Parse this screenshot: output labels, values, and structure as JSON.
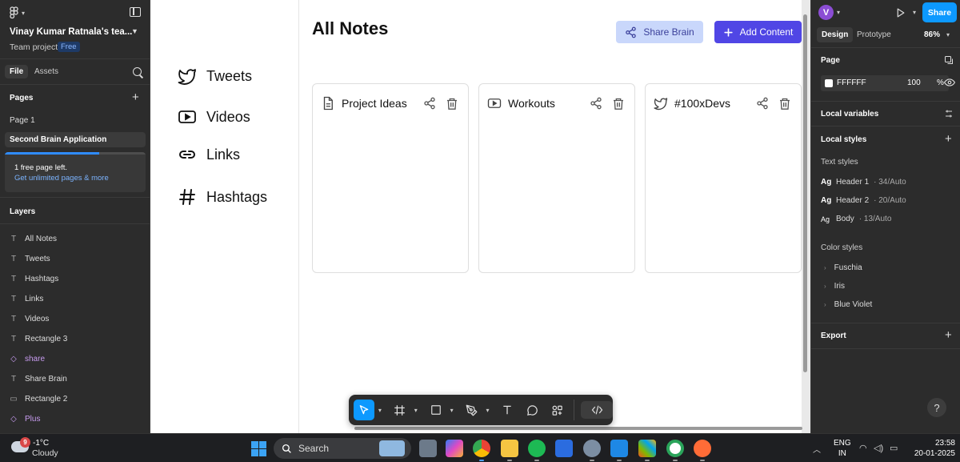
{
  "left_panel": {
    "team_name": "Vinay Kumar Ratnala's tea...",
    "team_project": "Team project",
    "plan_badge": "Free",
    "tabs": [
      "File",
      "Assets"
    ],
    "pages_title": "Pages",
    "pages": [
      "Page 1",
      "Second Brain Application"
    ],
    "upsell": {
      "line1": "1 free page left.",
      "line2": "Get unlimited pages & more",
      "pages_used_fraction": 0.67
    },
    "layers_title": "Layers",
    "layers": [
      {
        "name": "All Notes",
        "kind": "text"
      },
      {
        "name": "Tweets",
        "kind": "text"
      },
      {
        "name": "Hashtags",
        "kind": "text"
      },
      {
        "name": "Links",
        "kind": "text"
      },
      {
        "name": "Videos",
        "kind": "text"
      },
      {
        "name": "Rectangle 3",
        "kind": "text"
      },
      {
        "name": "share",
        "kind": "component"
      },
      {
        "name": "Share Brain",
        "kind": "text"
      },
      {
        "name": "Rectangle 2",
        "kind": "rectangle"
      },
      {
        "name": "Plus",
        "kind": "component"
      }
    ]
  },
  "canvas": {
    "nav": [
      {
        "label": "Tweets",
        "icon": "twitter-icon"
      },
      {
        "label": "Videos",
        "icon": "video-icon"
      },
      {
        "label": "Links",
        "icon": "link-icon"
      },
      {
        "label": "Hashtags",
        "icon": "hashtag-icon"
      }
    ],
    "title": "All Notes",
    "share_brain_label": "Share Brain",
    "add_content_label": "Add Content",
    "cards": [
      {
        "title": "Project Ideas",
        "icon": "document-icon"
      },
      {
        "title": "Workouts",
        "icon": "video-icon"
      },
      {
        "title": "#100xDevs",
        "icon": "twitter-icon"
      }
    ]
  },
  "right_panel": {
    "avatar_initial": "V",
    "share_label": "Share",
    "tabs": [
      "Design",
      "Prototype"
    ],
    "zoom": "86%",
    "page_title": "Page",
    "page_color": "FFFFFF",
    "page_opacity": "100",
    "page_opacity_unit": "%",
    "local_variables": "Local variables",
    "local_styles": "Local styles",
    "text_styles_title": "Text styles",
    "text_styles": [
      {
        "name": "Header 1",
        "meta": "· 34/Auto"
      },
      {
        "name": "Header 2",
        "meta": "· 20/Auto"
      },
      {
        "name": "Body",
        "meta": "· 13/Auto"
      }
    ],
    "color_styles_title": "Color styles",
    "color_styles": [
      "Fuschia",
      "Iris",
      "Blue Violet"
    ],
    "export": "Export",
    "help": "?"
  },
  "taskbar": {
    "weather_badge": "9",
    "temperature": "-1°C",
    "condition": "Cloudy",
    "search_label": "Search",
    "lang_line1": "ENG",
    "lang_line2": "IN",
    "time": "23:58",
    "date": "20-01-2025"
  },
  "colors": {
    "accent_blue": "#0d99ff",
    "add_content_bg": "#5046e5",
    "share_brain_bg": "#c9d7fb",
    "component_purple": "#c89cf0"
  }
}
